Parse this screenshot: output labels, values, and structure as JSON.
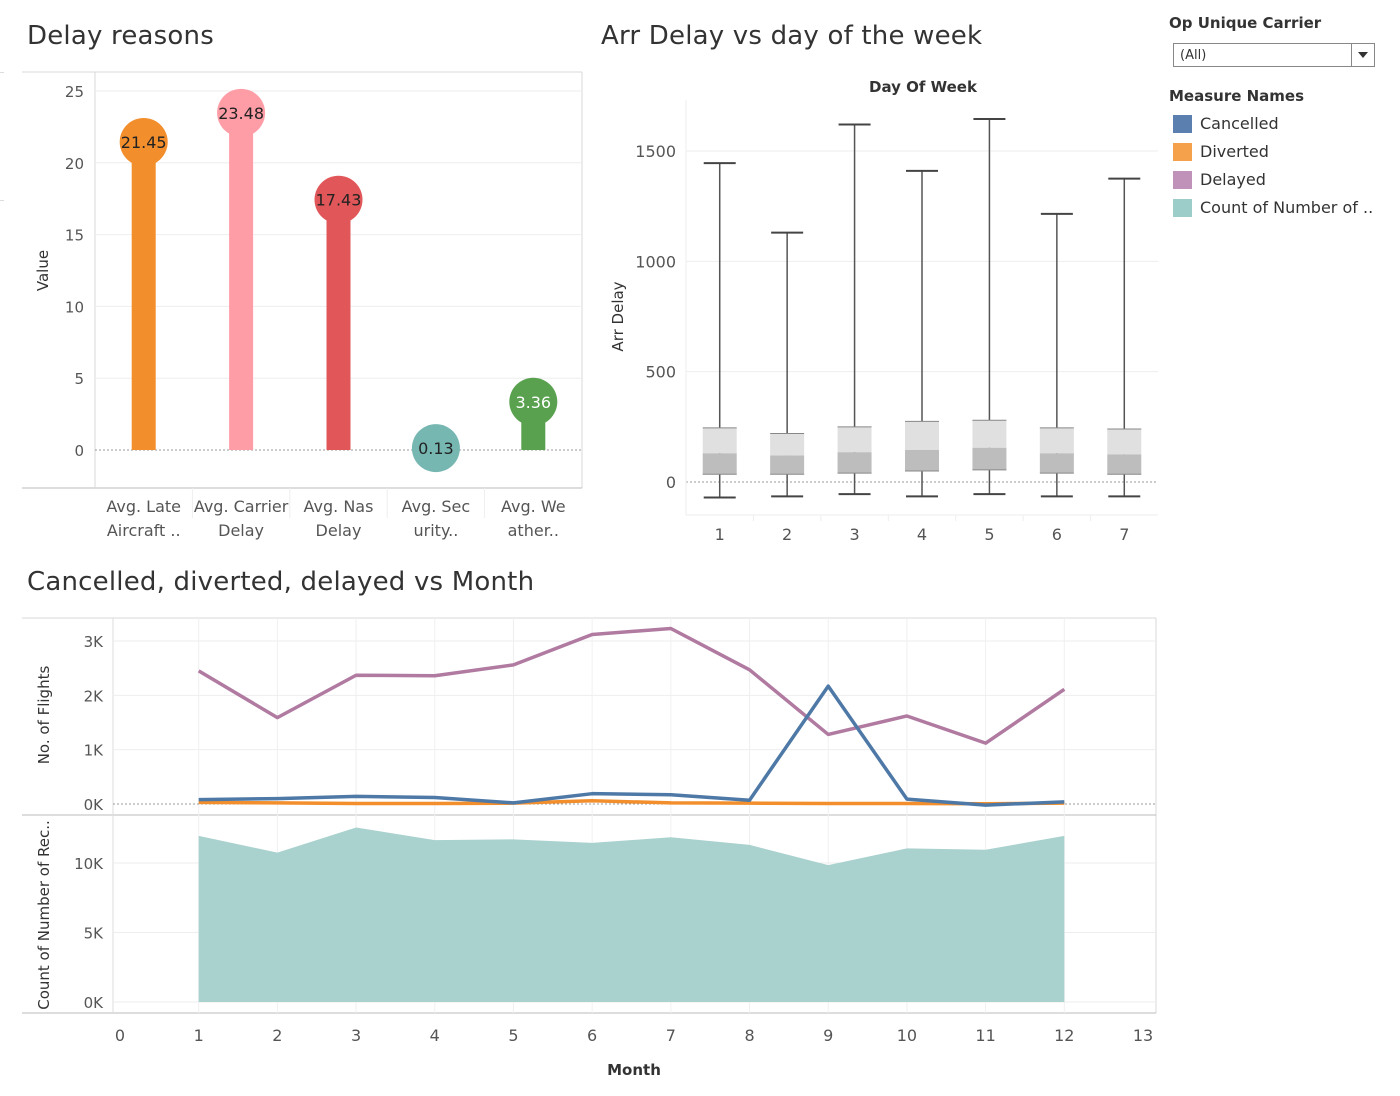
{
  "titles": {
    "delay_reasons": "Delay reasons",
    "arr_delay": "Arr Delay vs day of the week",
    "monthly": "Cancelled, diverted, delayed vs Month"
  },
  "filter": {
    "title": "Op Unique Carrier",
    "selected": "(All)"
  },
  "legend": {
    "title": "Measure Names",
    "items": [
      {
        "label": "Cancelled",
        "color": "#5b7fae"
      },
      {
        "label": "Diverted",
        "color": "#f5a04b"
      },
      {
        "label": "Delayed",
        "color": "#c092b9"
      },
      {
        "label": "Count of Number of ..",
        "color": "#9ccdc9"
      }
    ]
  },
  "chart_data": [
    {
      "type": "bar",
      "title": "Delay reasons",
      "ylabel": "Value",
      "ylim": [
        0,
        25
      ],
      "yticks": [
        0,
        5,
        10,
        15,
        20,
        25
      ],
      "categories": [
        [
          "Avg. Late",
          "Aircraft .."
        ],
        [
          "Avg. Carrier",
          "Delay"
        ],
        [
          "Avg. Nas",
          "Delay"
        ],
        [
          "Avg. Sec",
          "urity.."
        ],
        [
          "Avg. We",
          "ather.."
        ]
      ],
      "values": [
        21.45,
        23.48,
        17.43,
        0.13,
        3.36
      ],
      "labels": [
        "21.45",
        "23.48",
        "17.43",
        "0.13",
        "3.36"
      ],
      "colors": [
        "#f28e2b",
        "#ff9da7",
        "#e15759",
        "#76b7b2",
        "#59a14f"
      ],
      "label_colors": [
        "#222",
        "#222",
        "#222",
        "#222",
        "#fff"
      ]
    },
    {
      "type": "boxplot",
      "title": "Arr Delay vs day of the week",
      "xlabel": "Day Of Week",
      "ylabel": "Arr Delay",
      "ylim": [
        -120,
        1700
      ],
      "yticks": [
        0,
        500,
        1000,
        1500
      ],
      "categories": [
        "1",
        "2",
        "3",
        "4",
        "5",
        "6",
        "7"
      ],
      "boxes": [
        {
          "min": -70,
          "q1": 35,
          "median": 130,
          "q3": 245,
          "max": 1445
        },
        {
          "min": -65,
          "q1": 35,
          "median": 120,
          "q3": 220,
          "max": 1130
        },
        {
          "min": -55,
          "q1": 40,
          "median": 135,
          "q3": 250,
          "max": 1620
        },
        {
          "min": -65,
          "q1": 50,
          "median": 145,
          "q3": 275,
          "max": 1410
        },
        {
          "min": -55,
          "q1": 55,
          "median": 155,
          "q3": 280,
          "max": 1645
        },
        {
          "min": -65,
          "q1": 40,
          "median": 130,
          "q3": 245,
          "max": 1215
        },
        {
          "min": -65,
          "q1": 35,
          "median": 125,
          "q3": 240,
          "max": 1375
        }
      ]
    },
    {
      "type": "line",
      "title": "Cancelled, diverted, delayed vs Month",
      "xlabel": "Month",
      "ylabel": "No. of Flights",
      "xlim": [
        0,
        13
      ],
      "xticks": [
        0,
        1,
        2,
        3,
        4,
        5,
        6,
        7,
        8,
        9,
        10,
        11,
        12,
        13
      ],
      "ylim": [
        0,
        3000
      ],
      "yticks": [
        0,
        1000,
        2000,
        3000
      ],
      "ytick_labels": [
        "0K",
        "1K",
        "2K",
        "3K"
      ],
      "x": [
        1,
        2,
        3,
        4,
        5,
        6,
        7,
        8,
        9,
        10,
        11,
        12
      ],
      "series": [
        {
          "name": "Delayed",
          "color": "#b07aa1",
          "values": [
            2450,
            1590,
            2370,
            2360,
            2560,
            3120,
            3230,
            2470,
            1280,
            1620,
            1120,
            2110
          ]
        },
        {
          "name": "Cancelled",
          "color": "#4e79a7",
          "values": [
            80,
            100,
            140,
            120,
            20,
            190,
            170,
            70,
            2170,
            90,
            -20,
            40
          ]
        },
        {
          "name": "Diverted",
          "color": "#f28e2b",
          "values": [
            30,
            20,
            10,
            10,
            15,
            60,
            20,
            15,
            10,
            10,
            5,
            15
          ]
        }
      ]
    },
    {
      "type": "area",
      "ylabel": "Count of Number of Rec..",
      "xlabel": "Month",
      "ylim": [
        0,
        13000
      ],
      "yticks": [
        0,
        5000,
        10000
      ],
      "ytick_labels": [
        "0K",
        "5K",
        "10K"
      ],
      "x": [
        1,
        2,
        3,
        4,
        5,
        6,
        7,
        8,
        9,
        10,
        11,
        12
      ],
      "series": [
        {
          "name": "Count of Number of ..",
          "color": "#a9d1ce",
          "values": [
            11950,
            10750,
            12550,
            11650,
            11700,
            11450,
            11850,
            11300,
            9850,
            11050,
            10950,
            11950
          ]
        }
      ]
    }
  ]
}
